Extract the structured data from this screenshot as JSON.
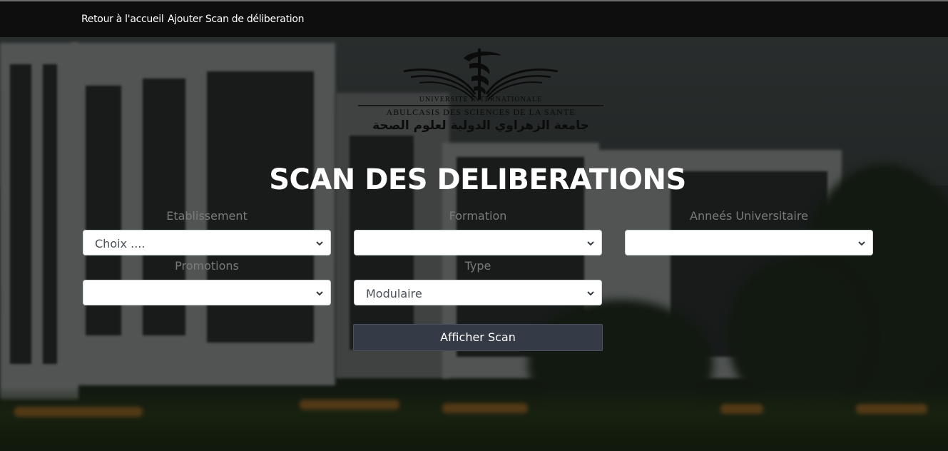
{
  "nav": {
    "home_label": "Retour à l'accueil",
    "add_scan_label": "Ajouter Scan de déliberation"
  },
  "logo": {
    "line1": "UNIVERSITE          INTERNATIONALE",
    "line2": "ABULCASIS DES SCIENCES DE LA SANTE",
    "arabic": "جامعة الزهراوي الدولية لعلوم الصحة"
  },
  "page": {
    "title": "SCAN DES DELIBERATIONS"
  },
  "form": {
    "etablissement": {
      "label": "Etablissement",
      "value": "Choix ...."
    },
    "formation": {
      "label": "Formation",
      "value": ""
    },
    "annees": {
      "label": "Anneés Universitaire",
      "value": ""
    },
    "promotions": {
      "label": "Promotions",
      "value": ""
    },
    "type": {
      "label": "Type",
      "value": "Modulaire"
    },
    "submit_label": "Afficher Scan"
  },
  "colors": {
    "navbar": "#0e0e0e",
    "button": "#343a46",
    "label": "#7a7a7a"
  },
  "icons": {
    "select_chevron": "chevron-down-icon"
  }
}
